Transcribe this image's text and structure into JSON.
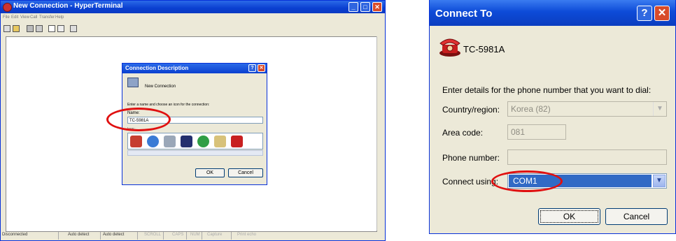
{
  "hyperterminal": {
    "title": "New Connection - HyperTerminal",
    "menu": [
      "File",
      "Edit",
      "View",
      "Call",
      "Transfer",
      "Help"
    ],
    "status": [
      "Disconnected",
      "Auto detect",
      "Auto detect",
      "SCROLL",
      "CAPS",
      "NUM",
      "Capture",
      "Print echo"
    ]
  },
  "connection_description": {
    "title": "Connection Description",
    "new_connection": "New Connection",
    "prompt": "Enter a name and choose an icon for the connection:",
    "name_label": "Name:",
    "name_value": "TC-5981A",
    "icon_label": "Icon:",
    "ok": "OK",
    "cancel": "Cancel"
  },
  "connect_to": {
    "title": "Connect To",
    "connection_name": "TC-5981A",
    "prompt": "Enter details for the phone number that you want to dial:",
    "country_label": "Country/region:",
    "country_value": "Korea (82)",
    "area_label": "Area code:",
    "area_value": "081",
    "phone_label": "Phone number:",
    "phone_value": "",
    "connect_label": "Connect using:",
    "connect_value": "COM1",
    "ok": "OK",
    "cancel": "Cancel"
  },
  "colors": {
    "titlebar": "#0a3fd0",
    "dialog_bg": "#ece9d8",
    "annotation": "#e01010",
    "selection": "#316ac5"
  }
}
